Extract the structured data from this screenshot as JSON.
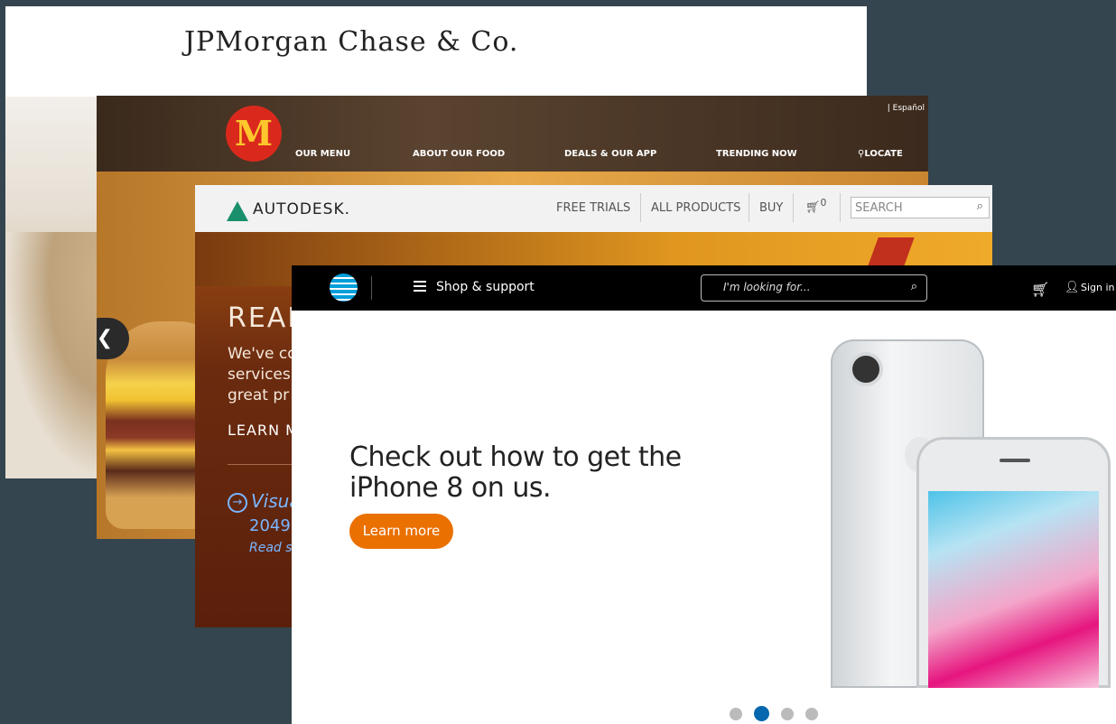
{
  "jpmorgan": {
    "logo": "JPMorgan Chase & Co."
  },
  "mcdonalds": {
    "language_link": "| Español",
    "nav": [
      "OUR MENU",
      "ABOUT OUR FOOD",
      "DEALS & OUR APP",
      "TRENDING NOW",
      "LOCATE"
    ],
    "logo_glyph": "M"
  },
  "autodesk": {
    "logo": "AUTODESK.",
    "nav": [
      "FREE TRIALS",
      "ALL PRODUCTS",
      "BUY"
    ],
    "cart_count": "0",
    "search_placeholder": "SEARCH",
    "hero_headline": "READ",
    "hero_body": "We've co services great pr",
    "learn_link": "LEARN M",
    "feature_link": "Visua",
    "feature_year": "2049",
    "feature_read": "Read s"
  },
  "att": {
    "nav_shop": "Shop & support",
    "search_placeholder": "I'm looking for...",
    "signin": "Sign in",
    "headline": "Check out how to get the iPhone 8 on us.",
    "cta": "Learn more",
    "carousel": {
      "count": 4,
      "active_index": 1
    },
    "brand_color": "#0568ae",
    "cta_color": "#ea7000"
  }
}
